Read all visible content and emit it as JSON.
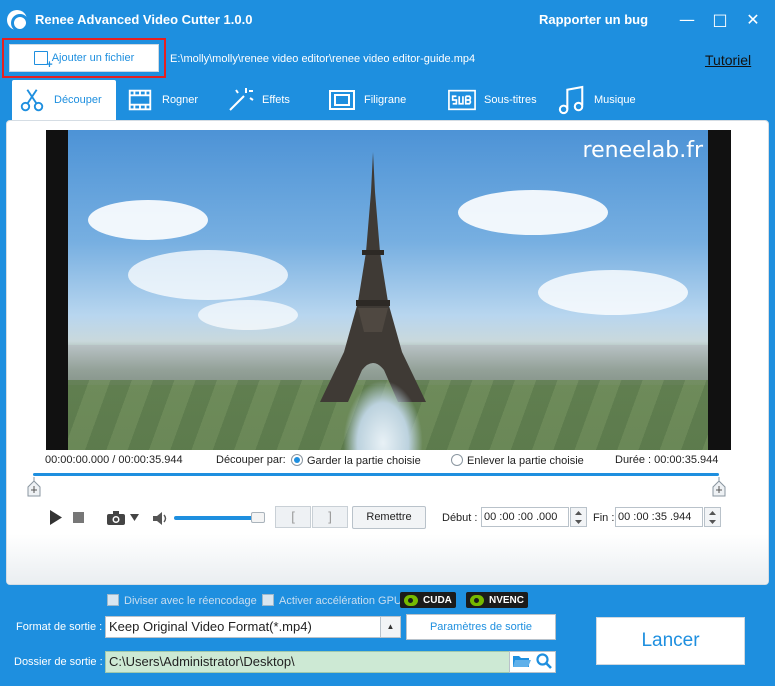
{
  "window": {
    "title": "Renee Advanced Video Cutter 1.0.0",
    "bug_report": "Rapporter un bug",
    "minimize": "—",
    "maximize": "□",
    "close": "✕"
  },
  "toolbar": {
    "add_file_label": "Ajouter un fichier",
    "file_path": "E:\\molly\\molly\\renee video editor\\renee video editor-guide.mp4",
    "tutorial_label": "Tutoriel"
  },
  "tabs": [
    {
      "label": "Découper",
      "icon": "scissors-icon",
      "active": true
    },
    {
      "label": "Rogner",
      "icon": "crop-icon",
      "active": false
    },
    {
      "label": "Effets",
      "icon": "magic-wand-icon",
      "active": false
    },
    {
      "label": "Filigrane",
      "icon": "watermark-icon",
      "active": false
    },
    {
      "label": "Sous-titres",
      "icon": "subtitle-icon",
      "active": false
    },
    {
      "label": "Musique",
      "icon": "music-note-icon",
      "active": false
    }
  ],
  "preview": {
    "watermark": "reneelab.fr",
    "time_display": "00:00:00.000 / 00:00:35.944",
    "cut_by_label": "Découper par:",
    "option_keep": "Garder la partie choisie",
    "option_remove": "Enlever la partie choisie",
    "duration": "Durée : 00:00:35.944"
  },
  "playback": {
    "reset_label": "Remettre",
    "start_label": "Début :",
    "start_value": "00 :00 :00 .000",
    "end_label": "Fin :",
    "end_value": "00 :00 :35 .944",
    "volume_level": 0.9,
    "bracket_in": "[",
    "bracket_out": "]"
  },
  "options": {
    "split_reencode": "Diviser avec le réencodage",
    "gpu_accel": "Activer accélération GPU",
    "cuda": "CUDA",
    "nvenc": "NVENC"
  },
  "output": {
    "format_label": "Format de sortie :",
    "format_value": "Keep Original Video Format(*.mp4)",
    "settings_button": "Paramètres de sortie",
    "folder_label": "Dossier de sortie :",
    "folder_value": "C:\\Users\\Administrator\\Desktop\\",
    "run_button": "Lancer"
  },
  "colors": {
    "accent": "#1e8fdf",
    "highlight_border": "#e52020"
  }
}
